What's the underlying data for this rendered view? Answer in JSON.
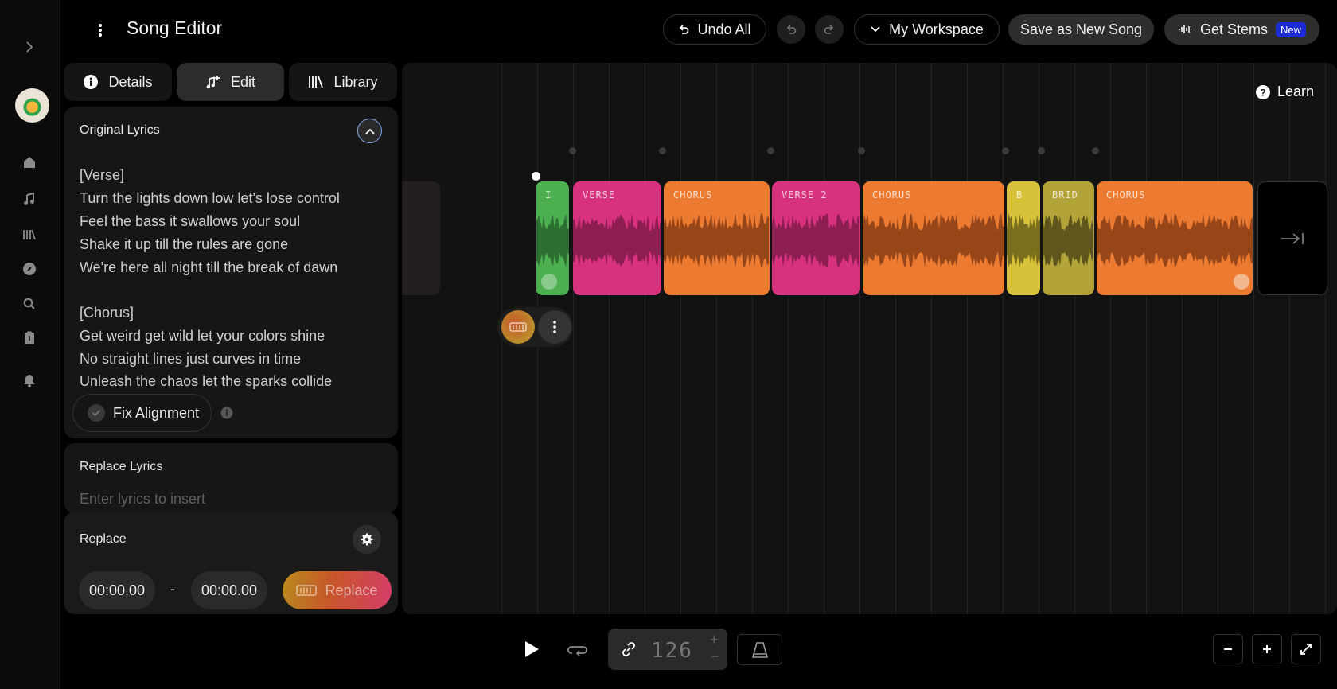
{
  "header": {
    "title": "Song Editor",
    "undo_all": "Undo All",
    "workspace": "My Workspace",
    "save_new": "Save as New Song",
    "get_stems": "Get Stems",
    "new_badge": "New"
  },
  "tabs": {
    "details": "Details",
    "edit": "Edit",
    "library": "Library"
  },
  "original_lyrics": {
    "title": "Original Lyrics",
    "lines": [
      "[Verse]",
      "Turn the lights down low let's lose control",
      "Feel the bass it swallows your soul",
      "Shake it up till the rules are gone",
      "We're here all night till the break of dawn",
      "",
      "[Chorus]",
      "Get weird get wild let your colors shine",
      "No straight lines just curves in time",
      "Unleash the chaos let the sparks collide"
    ],
    "fix_alignment": "Fix Alignment"
  },
  "replace_lyrics": {
    "title": "Replace Lyrics",
    "placeholder": "Enter lyrics to insert"
  },
  "replace": {
    "title": "Replace",
    "start": "00:00.00",
    "separator": "-",
    "end": "00:00.00",
    "button": "Replace"
  },
  "timeline": {
    "learn": "Learn",
    "sections": [
      {
        "label": "I",
        "color": "#4caf50",
        "dark": "#2d6f30"
      },
      {
        "label": "VERSE",
        "color": "#d8317e",
        "dark": "#8c1e52"
      },
      {
        "label": "CHORUS",
        "color": "#ec7a30",
        "dark": "#97461a"
      },
      {
        "label": "VERSE 2",
        "color": "#d8317e",
        "dark": "#8c1e52"
      },
      {
        "label": "CHORUS",
        "color": "#ec7a30",
        "dark": "#97461a"
      },
      {
        "label": "B",
        "color": "#d7c23a",
        "dark": "#7a6f1d"
      },
      {
        "label": "BRID",
        "color": "#b3a43a",
        "dark": "#5e561c"
      },
      {
        "label": "CHORUS",
        "color": "#ec7a30",
        "dark": "#97461a"
      }
    ]
  },
  "transport": {
    "bpm": "126"
  },
  "icons": [
    "menu-dots-icon",
    "chevron-right-icon",
    "home-icon",
    "music-note-icon",
    "library-icon",
    "compass-icon",
    "search-icon",
    "clipboard-icon",
    "bell-icon",
    "undo-icon",
    "redo-icon",
    "chevron-down-icon",
    "waveform-icon",
    "info-icon",
    "edit-icon",
    "chevron-up-icon",
    "settings-icon",
    "help-icon",
    "play-icon",
    "loop-icon",
    "link-icon",
    "metronome-icon",
    "zoom-out-icon",
    "zoom-in-icon",
    "expand-icon",
    "skip-to-end-icon"
  ]
}
